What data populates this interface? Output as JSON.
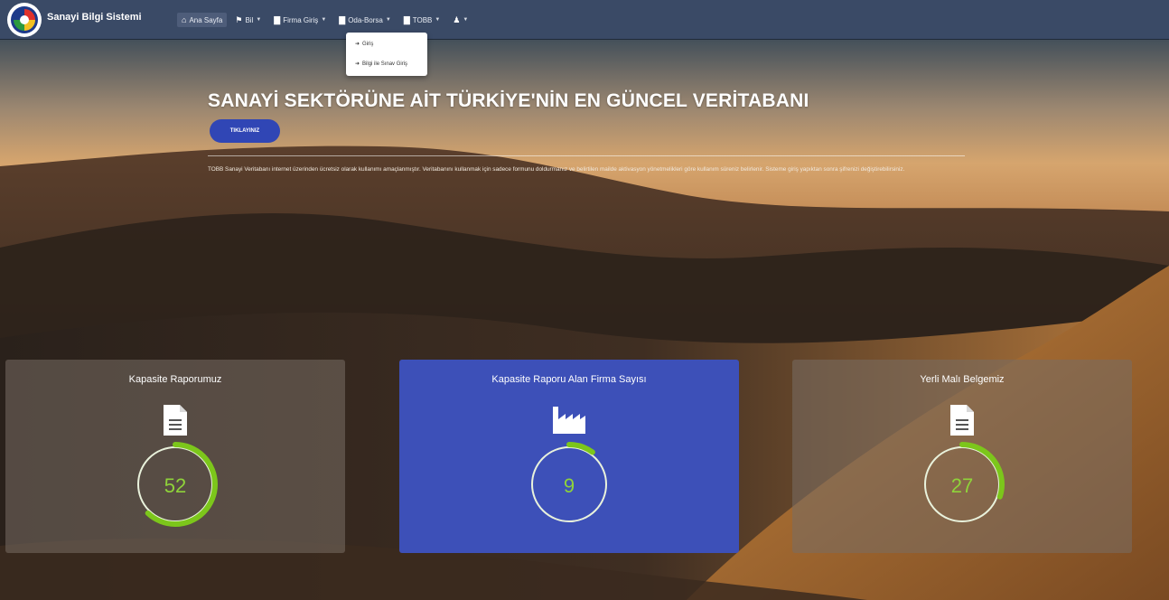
{
  "brand": {
    "name": "Sanayi Bilgi Sistemi"
  },
  "nav": {
    "items": [
      {
        "label": "Ana Sayfa",
        "icon": "home-icon",
        "glyph": "⌂",
        "active": true,
        "caret": false
      },
      {
        "label": "Bil",
        "icon": "flag-icon",
        "glyph": "⚑",
        "active": false,
        "caret": true
      },
      {
        "label": "Firma Giriş",
        "icon": "folder-icon",
        "glyph": "▇",
        "active": false,
        "caret": true
      },
      {
        "label": "Oda-Borsa",
        "icon": "folder-icon",
        "glyph": "▇",
        "active": false,
        "caret": true
      },
      {
        "label": "TOBB",
        "icon": "folder-icon",
        "glyph": "▇",
        "active": false,
        "caret": true
      },
      {
        "label": "",
        "icon": "user-icon",
        "glyph": "♟",
        "active": false,
        "caret": true
      }
    ]
  },
  "dropdown": {
    "items": [
      {
        "label": "Giriş",
        "icon": "sign-in-icon"
      },
      {
        "label": "Bilgi ile Sınav Giriş",
        "icon": "sign-in-icon"
      }
    ]
  },
  "hero": {
    "headline": "SANAYİ SEKTÖRÜNE AİT TÜRKİYE'NİN EN GÜNCEL VERİTABANI",
    "cta_label": "TIKLAYINIZ",
    "description": "TOBB Sanayi Veritabanı internet üzerinden ücretsiz olarak kullanımı amaçlanmıştır. Veritabanını kullanmak için sadece formunu doldurmanız ve belirtilen mailde aktivasyon yönetmelikleri göre kullanım süreniz belirlenir. Sisteme giriş yapıktan sonra şifrenizi değiştirebilirsiniz."
  },
  "stats": [
    {
      "title": "Kapasite Raporumuz",
      "icon": "document-icon",
      "value": "52",
      "progress": 0.62,
      "theme": "gray"
    },
    {
      "title": "Kapasite Raporu Alan Firma Sayısı",
      "icon": "factory-icon",
      "value": "9",
      "progress": 0.1,
      "theme": "blue"
    },
    {
      "title": "Yerli Malı Belgemiz",
      "icon": "document-icon",
      "value": "27",
      "progress": 0.3,
      "theme": "gray"
    }
  ],
  "colors": {
    "navbar": "#3a4a66",
    "accent_blue": "#3d50b8",
    "ring_green": "#7cc61b",
    "value_green": "#8fd33a"
  }
}
